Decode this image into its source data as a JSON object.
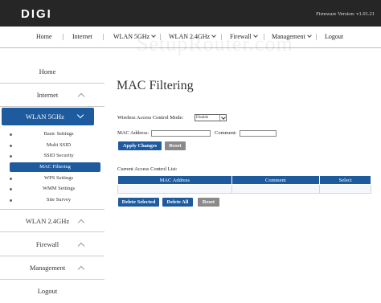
{
  "header": {
    "logo": "DIGI",
    "firmware": "Firmware Version: v1.01.21"
  },
  "topnav": {
    "items": [
      "Home",
      "Internet",
      "WLAN 5GHz",
      "WLAN 2.4GHz",
      "Firewall",
      "Management",
      "Logout"
    ]
  },
  "watermark": "SetupRouter.com",
  "sidebar": {
    "main": [
      {
        "label": "Home"
      },
      {
        "label": "Internet"
      },
      {
        "label": "WLAN 5GHz"
      },
      {
        "label": "WLAN 2.4GHz"
      },
      {
        "label": "Firewall"
      },
      {
        "label": "Management"
      },
      {
        "label": "Logout"
      }
    ],
    "sub": [
      "Basic Settings",
      "Multi SSID",
      "SSID Security",
      "MAC Filtering",
      "WPS Settings",
      "WMM Settings",
      "Site Survey"
    ]
  },
  "main": {
    "title": "MAC Filtering",
    "mode_label": "Wireless Access Control Mode:",
    "mode_value": "Disable",
    "mac_label": "MAC Address:",
    "comment_label": "Comment:",
    "mac_value": "",
    "comment_value": "",
    "apply_label": "Apply Changes",
    "reset_label": "Reset",
    "list_label": "Current Access Control List:",
    "columns": [
      "MAC Address",
      "Comment",
      "Select"
    ],
    "delete_selected_label": "Delete Selected",
    "delete_all_label": "Delete All",
    "reset2_label": "Reset"
  },
  "colors": {
    "accent": "#1d5a9e",
    "header": "#262626",
    "button_gray": "#8a8a8a"
  }
}
